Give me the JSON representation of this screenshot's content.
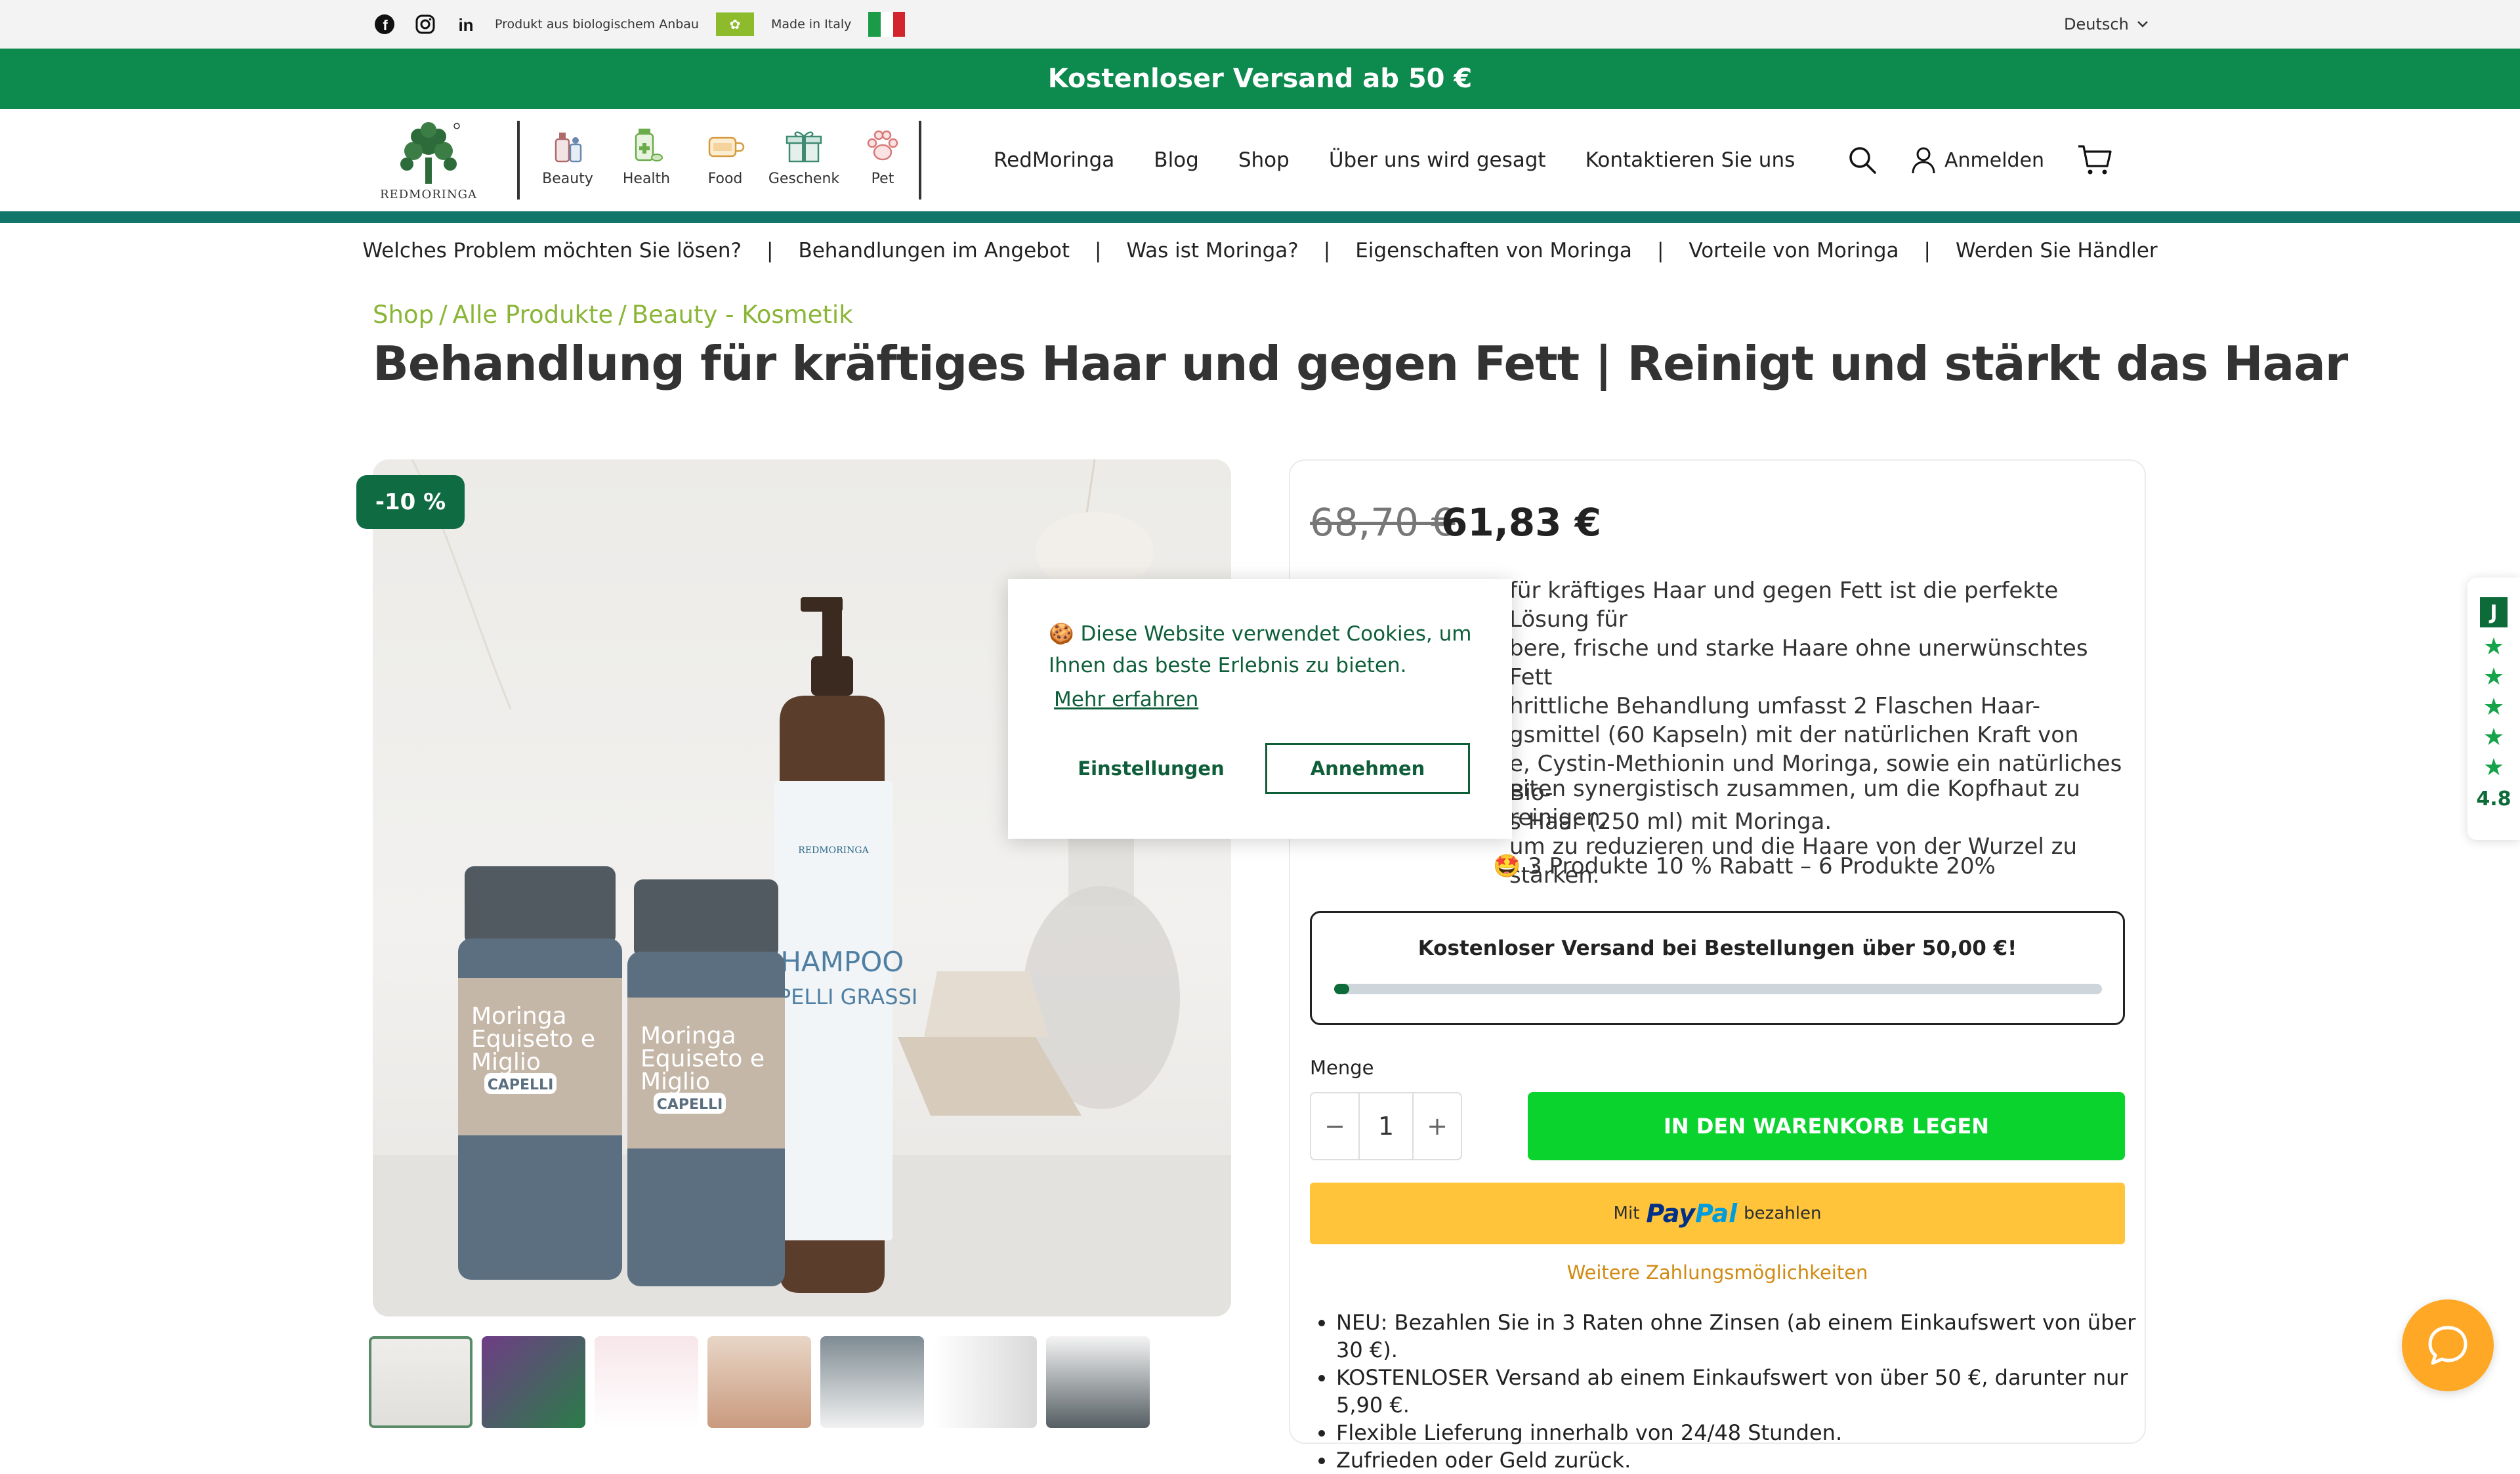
{
  "utility_bar": {
    "social_icons": [
      "facebook-icon",
      "instagram-icon",
      "linkedin-icon"
    ],
    "organic_text": "Produkt aus biologischem Anbau",
    "made_in_text": "Made in Italy",
    "language": "Deutsch"
  },
  "promo_banner": "Kostenloser Versand ab 50 €",
  "header": {
    "logo_text": "REDMORINGA",
    "categories": [
      {
        "label": "Beauty",
        "icon": "beauty-icon"
      },
      {
        "label": "Health",
        "icon": "health-icon"
      },
      {
        "label": "Food",
        "icon": "food-icon"
      },
      {
        "label": "Geschenk",
        "icon": "gift-icon"
      },
      {
        "label": "Pet",
        "icon": "paw-icon"
      }
    ],
    "nav": [
      "RedMoringa",
      "Blog",
      "Shop",
      "Über uns wird gesagt",
      "Kontaktieren Sie uns"
    ],
    "login": "Anmelden"
  },
  "subnav": [
    "Welches Problem möchten Sie lösen?",
    "Behandlungen im Angebot",
    "Was ist Moringa?",
    "Eigenschaften von Moringa",
    "Vorteile von Moringa",
    "Werden Sie Händler"
  ],
  "breadcrumb": [
    "Shop",
    "Alle Produkte",
    "Beauty - Kosmetik"
  ],
  "product": {
    "title": "Behandlung für kräftiges Haar und gegen Fett | Reinigt und stärkt das Haar",
    "discount_badge": "-10 %",
    "price_old": "68,70 €",
    "price_new": "61,83 €",
    "description_lines": [
      "für kräftiges Haar und gegen Fett ist die perfekte Lösung für",
      "bere, frische und starke Haare ohne unerwünschtes Fett",
      "hrittliche Behandlung umfasst 2 Flaschen Haar-",
      "gsmittel (60 Kapseln) mit der natürlichen Kraft von",
      "e, Cystin-Methionin und Moringa, sowie ein natürliches Bio-",
      "s Haar (250 ml) mit Moringa."
    ],
    "description2_lines": [
      "eiten synergistisch zusammen, um die Kopfhaut zu reinigen,",
      "um zu reduzieren und die Haare von der Wurzel zu stärken."
    ],
    "offer": "🤩 3 Produkte 10 % Rabatt – 6 Produkte 20%",
    "shipping_text": "Kostenloser Versand bei Bestellungen über 50,00 €!",
    "shipping_progress": 0.02,
    "quantity_label": "Menge",
    "quantity": "1",
    "add_to_cart": "IN DEN WARENKORB LEGEN",
    "paypal_prefix": "Mit",
    "paypal_logo_a": "Pay",
    "paypal_logo_b": "Pal",
    "paypal_suffix": "bezahlen",
    "more_payment": "Weitere Zahlungsmöglichkeiten",
    "bullets": [
      "NEU: Bezahlen Sie in 3 Raten ohne Zinsen (ab einem Einkaufswert von über 30 €).",
      "KOSTENLOSER Versand ab einem Einkaufswert von über 50 €, darunter nur 5,90 €.",
      "Flexible Lieferung innerhalb von 24/48 Stunden.",
      "Zufrieden oder Geld zurück."
    ],
    "gallery_labels": {
      "jar_line1": "Moringa",
      "jar_line2": "Equiseto e",
      "jar_line3": "Miglio",
      "jar_tag": "CAPELLI",
      "bottle_brand": "REDMORINGA",
      "bottle_line1": "SHAMPOO",
      "bottle_line2": "CAPELLI GRASSI"
    }
  },
  "cookie": {
    "message": "🍪 Diese Website verwendet Cookies, um Ihnen das beste Erlebnis zu bieten.",
    "learn_more": "Mehr erfahren",
    "settings": "Einstellungen",
    "accept": "Annehmen"
  },
  "review_widget": {
    "logo": "J",
    "score": "4.8"
  },
  "colors": {
    "brand_green": "#0d8a4e",
    "teal": "#12766b",
    "accent_lime": "#8ab536",
    "cart_green": "#0bd32e",
    "paypal_yellow": "#ffc439",
    "chat_orange": "#ffa826"
  }
}
